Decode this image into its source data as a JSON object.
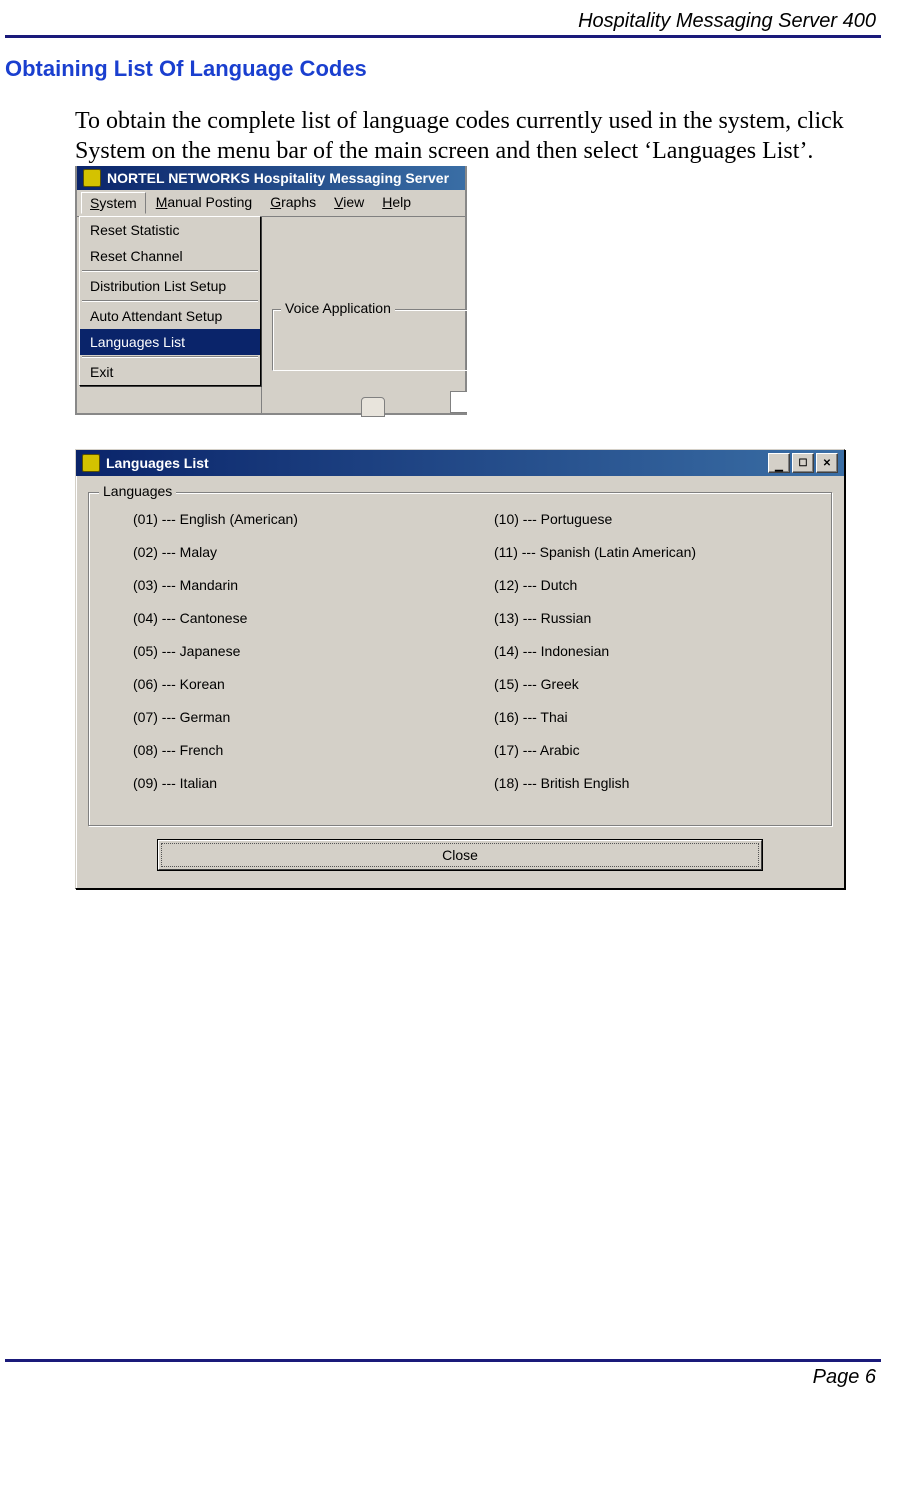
{
  "header": "Hospitality Messaging Server 400",
  "section_title": "Obtaining List Of Language Codes",
  "paragraph": "To obtain the complete list of language codes currently used in the system, click System on the menu bar of the main screen and then select ‘Languages List’.",
  "shot1": {
    "titlebar": "NORTEL NETWORKS Hospitality Messaging Server",
    "menu": {
      "items": [
        {
          "pre": "",
          "u": "S",
          "post": "ystem"
        },
        {
          "pre": "",
          "u": "M",
          "post": "anual Posting"
        },
        {
          "pre": "",
          "u": "G",
          "post": "raphs"
        },
        {
          "pre": "",
          "u": "V",
          "post": "iew"
        },
        {
          "pre": "",
          "u": "H",
          "post": "elp"
        }
      ]
    },
    "dropdown": [
      "Reset Statistic",
      "Reset Channel",
      "Distribution List Setup",
      "Auto Attendant Setup",
      "Languages List",
      "Exit"
    ],
    "side_label": "Voice Application"
  },
  "shot2": {
    "titlebar": "Languages List",
    "group_label": "Languages",
    "col1": [
      "(01) --- English (American)",
      "(02) --- Malay",
      "(03) --- Mandarin",
      "(04) --- Cantonese",
      "(05) --- Japanese",
      "(06) --- Korean",
      "(07) --- German",
      "(08) --- French",
      "(09) --- Italian"
    ],
    "col2": [
      "(10) --- Portuguese",
      "(11) --- Spanish (Latin American)",
      "(12) --- Dutch",
      "(13) --- Russian",
      "(14) --- Indonesian",
      "(15) --- Greek",
      "(16) --- Thai",
      "(17) --- Arabic",
      "(18) --- British English"
    ],
    "close_label": "Close"
  },
  "footer": "Page 6"
}
